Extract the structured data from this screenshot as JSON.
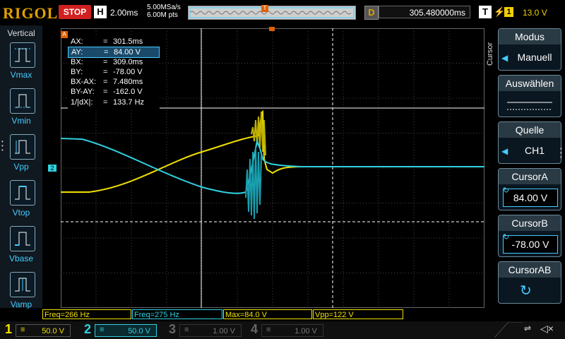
{
  "top": {
    "brand": "RIGOL",
    "run_state": "STOP",
    "horiz_label": "H",
    "timebase": "2.00ms",
    "sample_rate": "5.00MSa/s",
    "mem_depth": "6.00M pts",
    "trigger_pos_marker": "T",
    "delay_label": "D",
    "delay_value": "305.480000ms",
    "trigger_label": "T",
    "trigger_edge_icon": "rising-edge-icon",
    "trigger_source": "1",
    "trigger_level": "13.0 V"
  },
  "left_menu": {
    "title": "Vertical",
    "items": [
      {
        "label": "Vmax",
        "icon": "vmax-icon"
      },
      {
        "label": "Vmin",
        "icon": "vmin-icon"
      },
      {
        "label": "Vpp",
        "icon": "vpp-icon"
      },
      {
        "label": "Vtop",
        "icon": "vtop-icon"
      },
      {
        "label": "Vbase",
        "icon": "vbase-icon"
      },
      {
        "label": "Vamp",
        "icon": "vamp-icon"
      }
    ]
  },
  "cursor_readout": {
    "rows": [
      {
        "key": "AX:",
        "eq": "=",
        "val": "301.5ms"
      },
      {
        "key": "AY:",
        "eq": "=",
        "val": "84.00 V"
      },
      {
        "key": "BX:",
        "eq": "=",
        "val": "309.0ms"
      },
      {
        "key": "BY:",
        "eq": "=",
        "val": "-78.00 V"
      },
      {
        "key": "BX-AX:",
        "eq": "=",
        "val": "7.480ms"
      },
      {
        "key": "BY-AY:",
        "eq": "=",
        "val": "-162.0 V"
      },
      {
        "key": "1/|dX|:",
        "eq": "=",
        "val": "133.7 Hz"
      }
    ]
  },
  "right_menu": {
    "tab_label": "Cursor",
    "modus": {
      "title": "Modus",
      "value": "Manuell"
    },
    "auswaehlen": {
      "title": "Auswählen"
    },
    "quelle": {
      "title": "Quelle",
      "value": "CH1"
    },
    "cursor_a": {
      "title": "CursorA",
      "value": "84.00 V"
    },
    "cursor_b": {
      "title": "CursorB",
      "value": "-78.00 V"
    },
    "cursor_ab": {
      "title": "CursorAB"
    }
  },
  "measurements": [
    {
      "text": "Freq=266 Hz",
      "color": "#f0e000"
    },
    {
      "text": "Freq=275 Hz",
      "color": "#30d0e0"
    },
    {
      "text": "Max=84.0 V",
      "color": "#f0e000"
    },
    {
      "text": "Vpp=122 V",
      "color": "#f0e000"
    }
  ],
  "channels": [
    {
      "num": "1",
      "coupling": "≡",
      "scale": "50.0 V",
      "color": "#f0e000",
      "active": true
    },
    {
      "num": "2",
      "coupling": "≡",
      "scale": "50.0 V",
      "color": "#30d0e0",
      "active": true
    },
    {
      "num": "3",
      "coupling": "≡",
      "scale": "1.00 V",
      "color": "#888888",
      "active": false
    },
    {
      "num": "4",
      "coupling": "≡",
      "scale": "1.00 V",
      "color": "#888888",
      "active": false
    }
  ],
  "status_icons": {
    "usb": "usb-icon",
    "speaker": "speaker-muted-icon"
  },
  "ch2_marker": "2",
  "cursor_a_marker": "A",
  "colors": {
    "ch1": "#f0e000",
    "ch2": "#30d0e0",
    "accent": "#4cf",
    "trigger": "#e06000"
  }
}
